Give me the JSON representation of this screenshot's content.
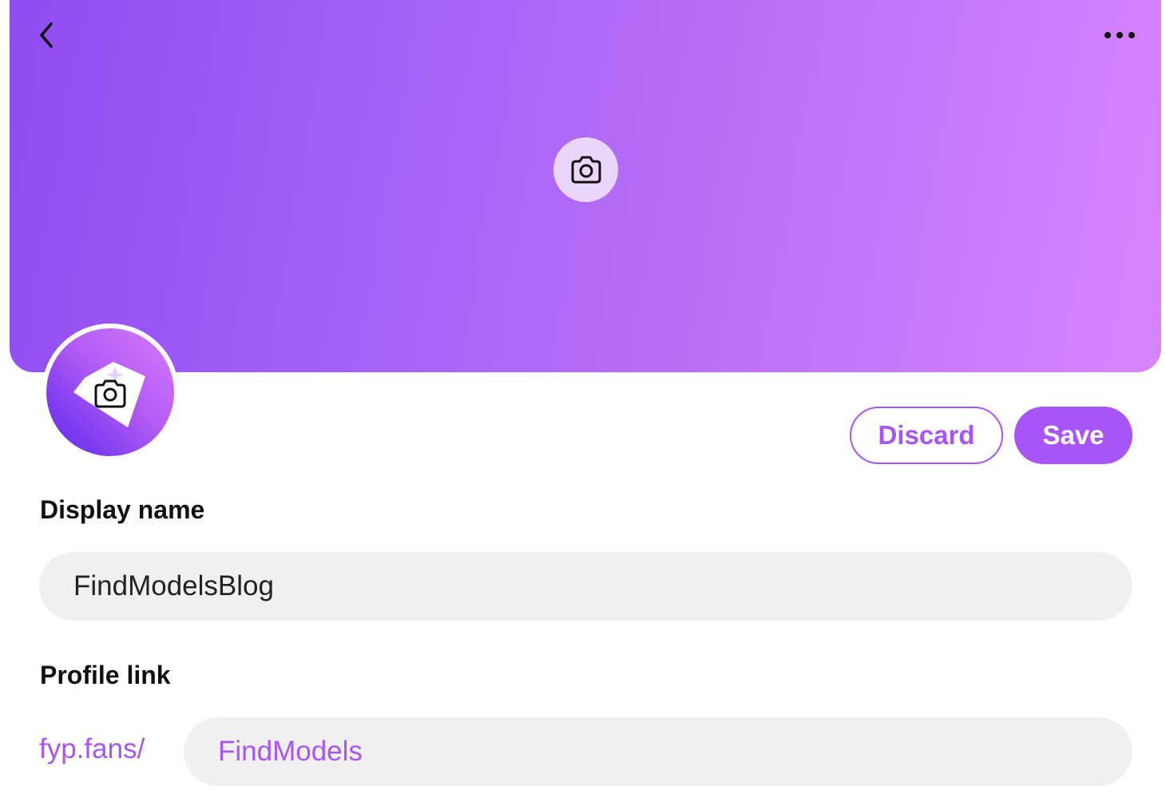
{
  "header": {
    "back_icon": "chevron-left-icon",
    "more_icon": "more-horizontal-icon"
  },
  "banner": {
    "camera_icon": "camera-icon",
    "gradient_colors": [
      "#904cf2",
      "#d884ff"
    ]
  },
  "avatar": {
    "camera_icon": "camera-icon",
    "logo_icon": "sparkle-logo-icon"
  },
  "actions": {
    "discard_label": "Discard",
    "save_label": "Save"
  },
  "form": {
    "display_name": {
      "label": "Display name",
      "value": "FindModelsBlog"
    },
    "profile_link": {
      "label": "Profile link",
      "prefix": "fyp.fans/",
      "value": "FindModels"
    }
  },
  "colors": {
    "accent": "#a855f7",
    "input_bg": "#f0f0f0",
    "text": "#111111"
  }
}
